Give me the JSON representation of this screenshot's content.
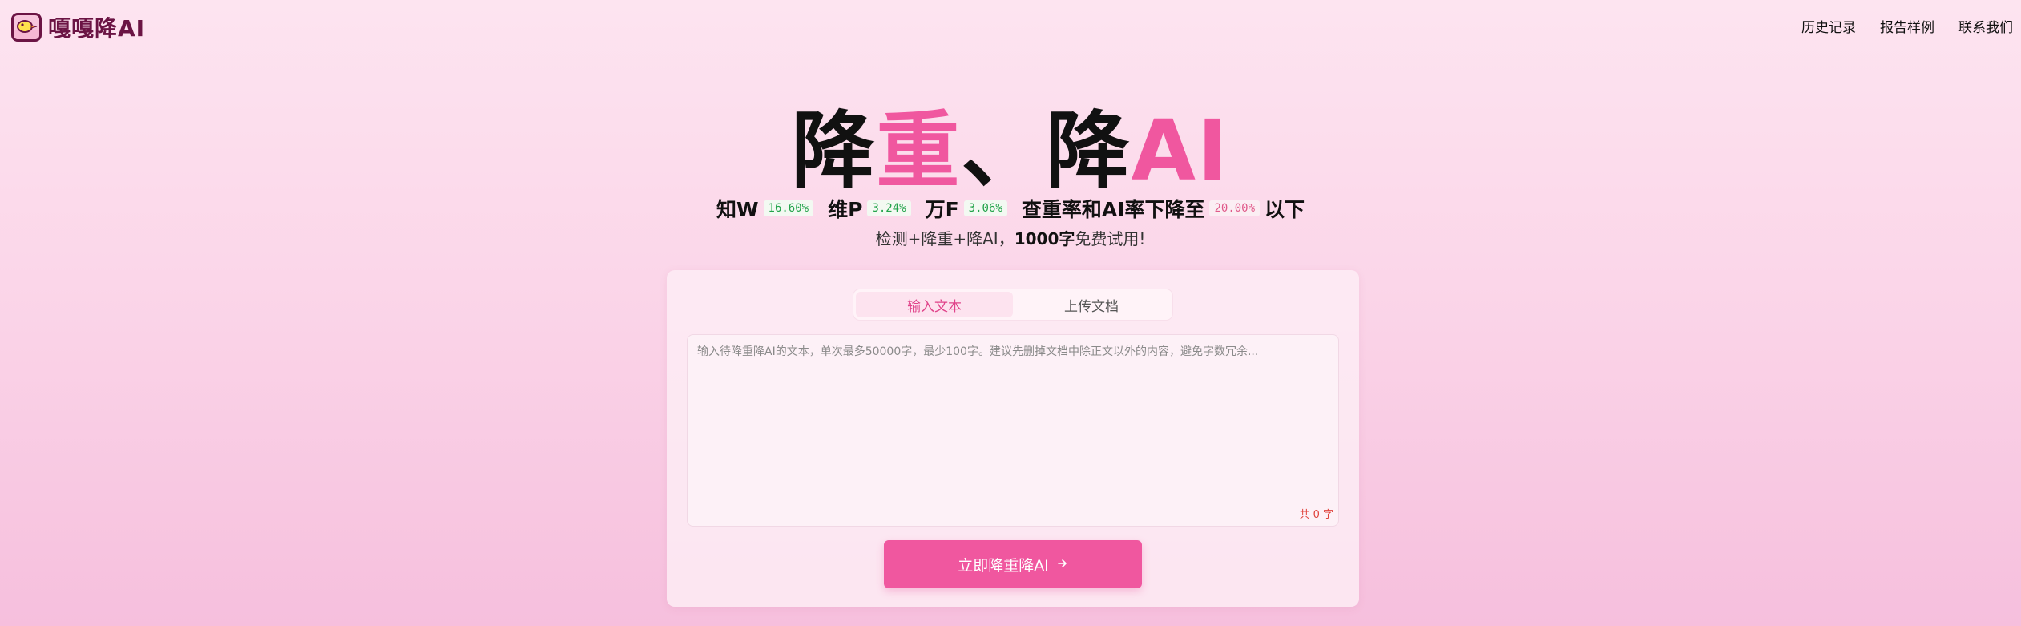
{
  "header": {
    "logo_text": "嘎嘎降AI",
    "nav": [
      "历史记录",
      "报告样例",
      "联系我们"
    ]
  },
  "hero": {
    "title_parts": [
      "降",
      "重",
      "、",
      "降",
      "AI"
    ],
    "stats": [
      {
        "label": "知W",
        "value": "16.60%"
      },
      {
        "label": "维P",
        "value": "3.24%"
      },
      {
        "label": "万F",
        "value": "3.06%"
      }
    ],
    "target_prefix": "查重率和AI率下降至",
    "target_value": "20.00%",
    "target_suffix": "以下",
    "subtitle_prefix": "检测+降重+降AI，",
    "subtitle_bold": "1000字",
    "subtitle_suffix": "免费试用!"
  },
  "card": {
    "tabs": [
      {
        "label": "输入文本",
        "active": true
      },
      {
        "label": "上传文档",
        "active": false
      }
    ],
    "textarea": {
      "value": "",
      "placeholder": "输入待降重降AI的文本，单次最多50000字，最少100字。建议先删掉文档中除正文以外的内容，避免字数冗余..."
    },
    "count_label": "共 0 字",
    "submit_label": "立即降重降AI",
    "submit_icon": "arrow-right-icon"
  },
  "colors": {
    "accent": "#f0579f",
    "brand_dark": "#6b1444",
    "stat_green": "#22a34a",
    "stat_red": "#e05a8a"
  }
}
